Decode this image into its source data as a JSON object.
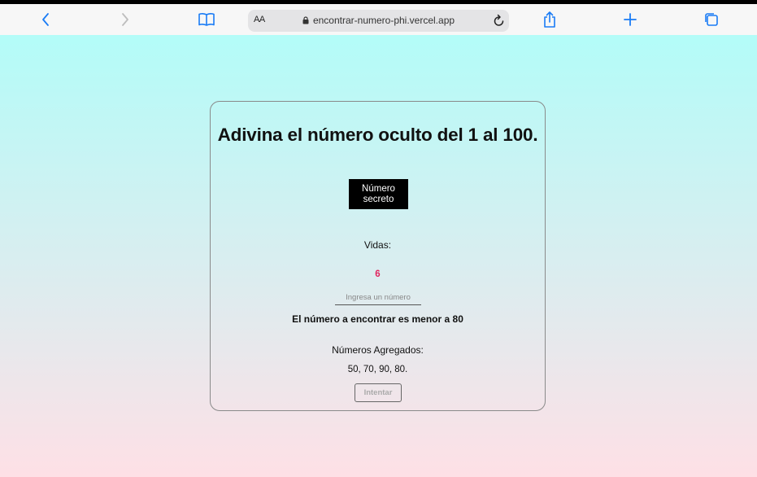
{
  "browser": {
    "text_size_label": "AA",
    "url": "encontrar-numero-phi.vercel.app",
    "accent_color": "#1a7cf5"
  },
  "game": {
    "title": "Adivina el número oculto del 1 al 100.",
    "secret_button": "Número secreto",
    "lives_label": "Vidas:",
    "lives_value": "6",
    "input_placeholder": "Ingresa un número",
    "hint": "El número a encontrar es menor a 80",
    "added_label": "Números Agregados:",
    "added_values": "50, 70, 90, 80.",
    "try_button": "Intentar"
  }
}
